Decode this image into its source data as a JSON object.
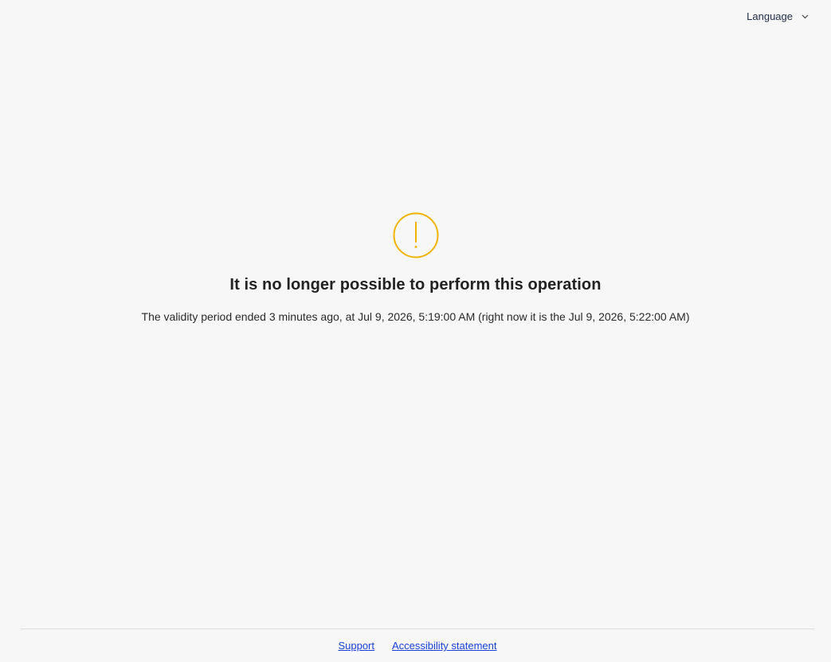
{
  "header": {
    "language_label": "Language"
  },
  "icons": {
    "warning": "exclamation-circle-icon",
    "chevron": "chevron-down-icon"
  },
  "colors": {
    "warning": "#f0b400",
    "link": "#1a3fd6",
    "background": "#f7f7f7"
  },
  "main": {
    "title": "It is no longer possible to perform this operation",
    "message": "The validity period ended 3 minutes ago, at Jul 9, 2026, 5:19:00 AM (right now it is the Jul 9, 2026, 5:22:00 AM)"
  },
  "footer": {
    "support_label": "Support",
    "accessibility_label": "Accessibility statement"
  }
}
